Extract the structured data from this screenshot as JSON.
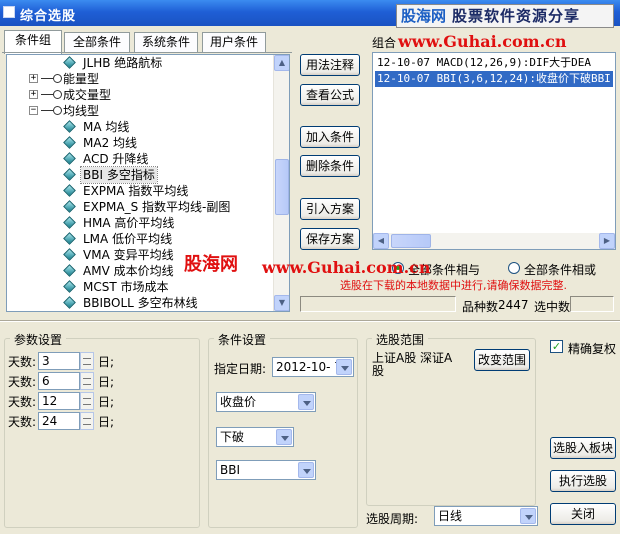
{
  "window": {
    "title": "综合选股"
  },
  "watermark": {
    "brand": "股海网",
    "slogan": "股票软件资源分享",
    "url": "www.Guhai.com.cn",
    "center_brand": "股海网",
    "center_url": "www.Guhai.com.cn"
  },
  "tabs": [
    "条件组",
    "全部条件",
    "系统条件",
    "用户条件"
  ],
  "tree": {
    "items": [
      {
        "label": "JLHB 绝路航标",
        "type": "leaf"
      },
      {
        "label": "能量型",
        "type": "category",
        "expander": "+"
      },
      {
        "label": "成交量型",
        "type": "category",
        "expander": "+"
      },
      {
        "label": "均线型",
        "type": "category",
        "expander": "−"
      },
      {
        "label": "MA 均线",
        "type": "leaf"
      },
      {
        "label": "MA2 均线",
        "type": "leaf"
      },
      {
        "label": "ACD 升降线",
        "type": "leaf"
      },
      {
        "label": "BBI 多空指标",
        "type": "leaf",
        "selected": true
      },
      {
        "label": "EXPMA 指数平均线",
        "type": "leaf"
      },
      {
        "label": "EXPMA_S 指数平均线-副图",
        "type": "leaf"
      },
      {
        "label": "HMA 高价平均线",
        "type": "leaf"
      },
      {
        "label": "LMA 低价平均线",
        "type": "leaf"
      },
      {
        "label": "VMA 变异平均线",
        "type": "leaf"
      },
      {
        "label": "AMV 成本价均线",
        "type": "leaf"
      },
      {
        "label": "MCST 市场成本",
        "type": "leaf"
      },
      {
        "label": "BBIBOLL 多空布林线",
        "type": "leaf"
      }
    ]
  },
  "middle_buttons": {
    "usage_note": "用法注释",
    "view_formula": "查看公式",
    "add_condition": "加入条件",
    "delete_condition": "删除条件",
    "import_plan": "引入方案",
    "save_plan": "保存方案"
  },
  "plan": {
    "label": "组合",
    "rows": [
      {
        "text": "12-10-07 MACD(12,26,9):DIF大于DEA",
        "selected": false
      },
      {
        "text": "12-10-07 BBI(3,6,12,24):收盘价下破BBI",
        "selected": true
      }
    ],
    "and_label": "全部条件相与",
    "or_label": "全部条件相或",
    "and_selected": true
  },
  "status": {
    "note": "选股在下载的本地数据中进行,请确保数据完整.",
    "count_label": "品种数",
    "count_value": "2447",
    "selected_label": "选中数",
    "selected_value": ""
  },
  "params": {
    "title": "参数设置",
    "rows": [
      {
        "label": "天数:",
        "value": "3",
        "unit": "日;"
      },
      {
        "label": "天数:",
        "value": "6",
        "unit": "日;"
      },
      {
        "label": "天数:",
        "value": "12",
        "unit": "日;"
      },
      {
        "label": "天数:",
        "value": "24",
        "unit": "日;"
      }
    ]
  },
  "conditions": {
    "title": "条件设置",
    "date_label": "指定日期:",
    "date_value": "2012-10- 7",
    "price_select": "收盘价",
    "direction_select": "下破",
    "indicator_select": "BBI"
  },
  "range": {
    "title": "选股范围",
    "text": "上证A股 深证A股",
    "change_button": "改变范围",
    "period_label": "选股周期:",
    "period_value": "日线"
  },
  "right_panel": {
    "precise_label": "精确复权",
    "precise_checked": true,
    "to_block_button": "选股入板块",
    "execute_button": "执行选股",
    "close_button": "关闭"
  },
  "colors": {
    "accent_red": "#e01010",
    "selection_blue": "#316ac5",
    "title_blue": "#1f5fd6"
  }
}
